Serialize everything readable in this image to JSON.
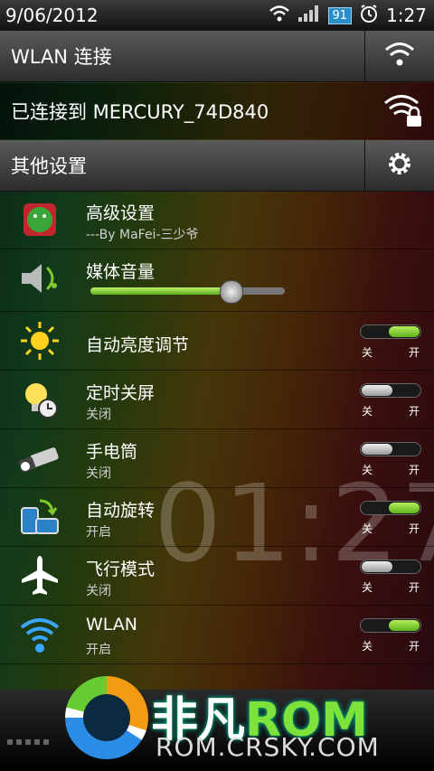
{
  "status": {
    "date": "9/06/2012",
    "battery": "91",
    "time": "1:27"
  },
  "header_wlan": {
    "title": "WLAN 连接"
  },
  "connected": {
    "title": "已连接到 MERCURY_74D840"
  },
  "header_other": {
    "title": "其他设置"
  },
  "rows": {
    "advanced": {
      "label": "高级设置",
      "sub": "---By MaFei-三少爷"
    },
    "media": {
      "label": "媒体音量",
      "volume_percent": 72
    },
    "auto_brightness": {
      "label": "自动亮度调节",
      "state": "on",
      "off": "关",
      "on": "开"
    },
    "screen_timer": {
      "label": "定时关屏",
      "sub": "关闭",
      "state": "off",
      "off": "关",
      "on": "开"
    },
    "flashlight": {
      "label": "手电筒",
      "sub": "关闭",
      "state": "off",
      "off": "关",
      "on": "开"
    },
    "auto_rotate": {
      "label": "自动旋转",
      "sub": "开启",
      "state": "on",
      "off": "关",
      "on": "开"
    },
    "airplane": {
      "label": "飞行模式",
      "sub": "关闭",
      "state": "off",
      "off": "关",
      "on": "开"
    },
    "wlan": {
      "label": "WLAN",
      "sub": "开启",
      "state": "on",
      "off": "关",
      "on": "开"
    }
  },
  "background": {
    "clock": "01:27"
  },
  "watermark": {
    "brand": "非凡",
    "rom": "ROM",
    "url": "ROM.CRSKY.COM"
  }
}
